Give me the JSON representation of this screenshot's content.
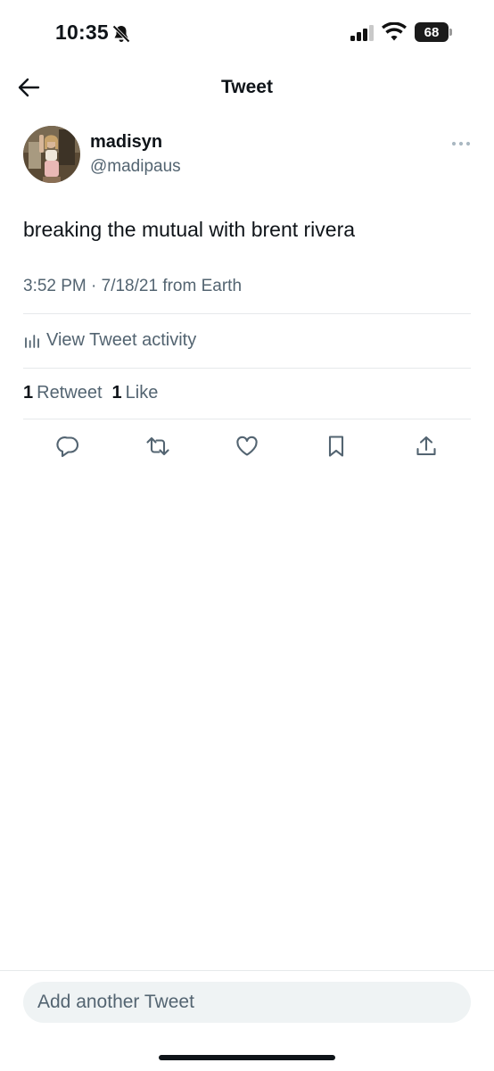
{
  "status_bar": {
    "time": "10:35",
    "battery": "68",
    "icons": [
      "bell-muted-icon",
      "signal-icon",
      "wifi-icon",
      "battery-icon"
    ]
  },
  "nav": {
    "back_icon": "arrow-left-icon",
    "title": "Tweet"
  },
  "tweet": {
    "display_name": "madisyn",
    "handle": "@madipaus",
    "text": "breaking the mutual with brent rivera",
    "timestamp": "3:52 PM · 7/18/21 from Earth",
    "activity_label": "View Tweet activity",
    "stats": {
      "retweet_count": "1",
      "retweet_label": "Retweet",
      "like_count": "1",
      "like_label": "Like"
    },
    "actions": [
      "reply-icon",
      "retweet-icon",
      "like-icon",
      "bookmark-icon",
      "share-icon"
    ]
  },
  "composer": {
    "placeholder": "Add another Tweet"
  },
  "colors": {
    "text_primary": "#0f1419",
    "text_secondary": "#536471",
    "divider": "#e6e9eb",
    "composer_bg": "#eff3f4"
  }
}
